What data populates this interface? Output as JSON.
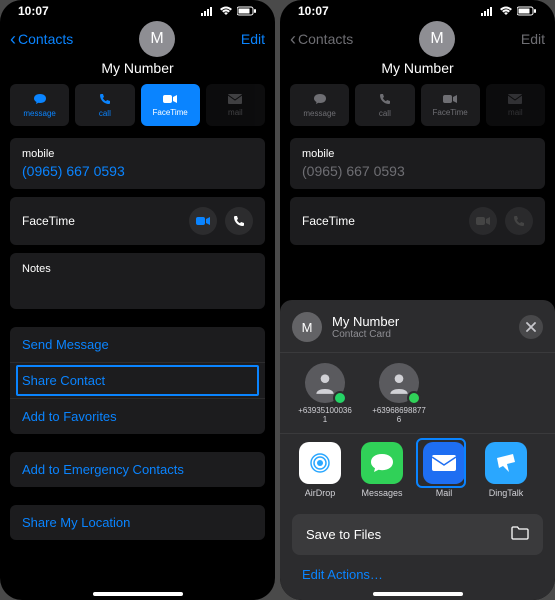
{
  "status": {
    "time": "10:07"
  },
  "nav": {
    "back_label": "Contacts",
    "edit_label": "Edit",
    "avatar_initial": "M",
    "contact_name": "My Number"
  },
  "quick": {
    "message": "message",
    "call": "call",
    "facetime": "FaceTime",
    "mail": "mail"
  },
  "mobile": {
    "label": "mobile",
    "number": "(0965) 667 0593"
  },
  "facetime_label": "FaceTime",
  "notes_label": "Notes",
  "actions": {
    "send_message": "Send Message",
    "share_contact": "Share Contact",
    "add_favorites": "Add to Favorites",
    "add_emergency": "Add to Emergency Contacts",
    "share_location": "Share My Location"
  },
  "sheet": {
    "title": "My Number",
    "subtitle": "Contact Card",
    "people": [
      {
        "label": "+639351000361"
      },
      {
        "label": "+639686988776"
      }
    ],
    "apps": {
      "airdrop": "AirDrop",
      "messages": "Messages",
      "mail": "Mail",
      "dingtalk": "DingTalk"
    },
    "save_to_files": "Save to Files",
    "edit_actions": "Edit Actions…"
  }
}
